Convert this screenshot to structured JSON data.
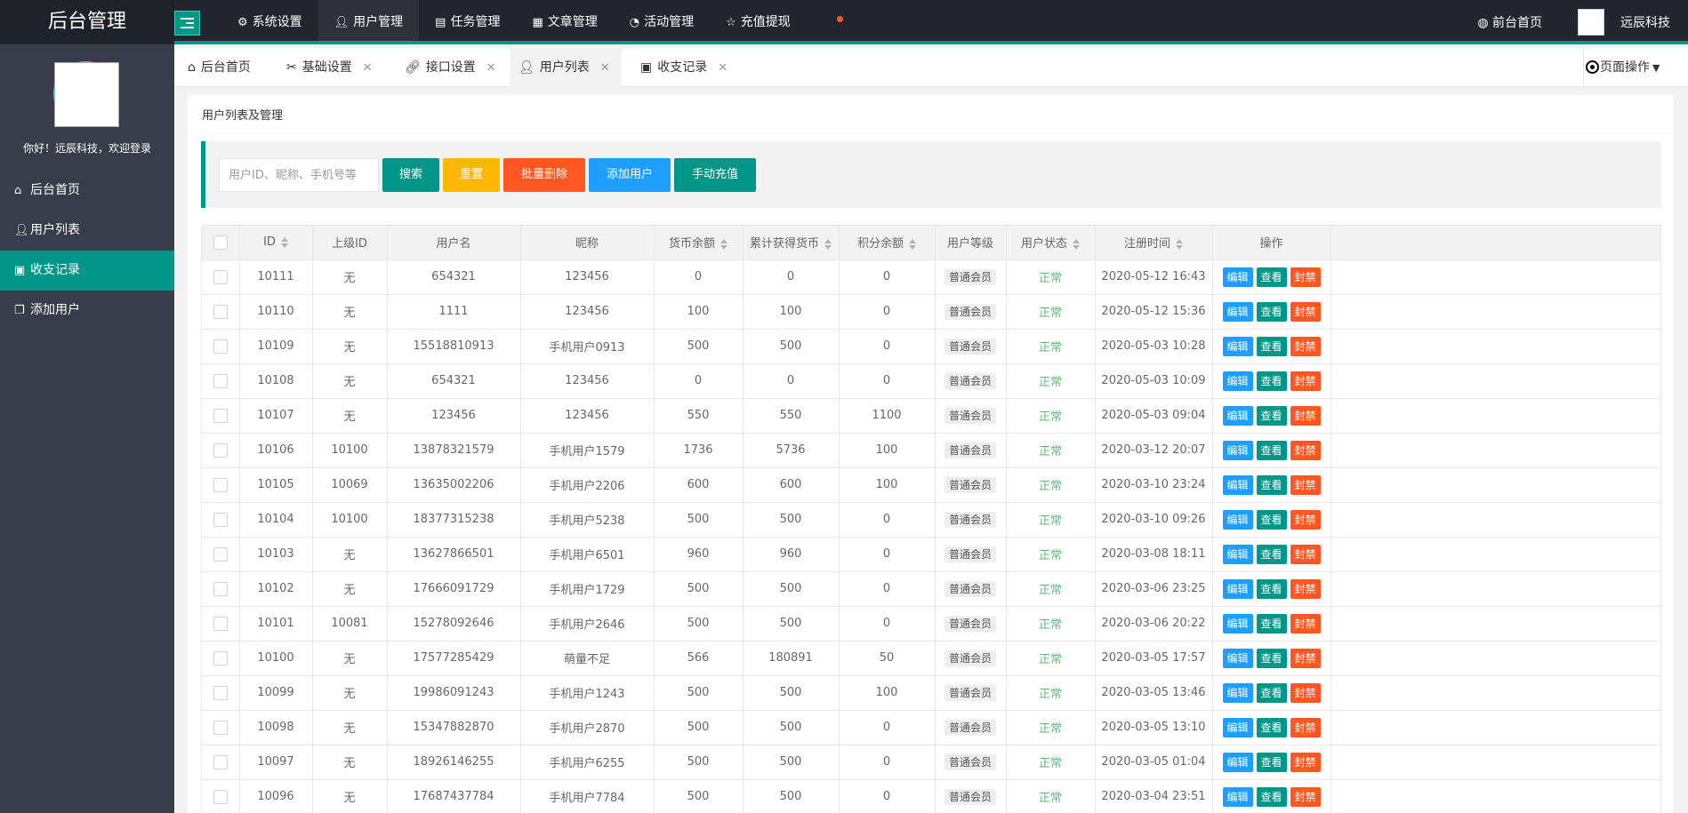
{
  "app": {
    "title": "后台管理"
  },
  "topnav": [
    {
      "label": "系统设置",
      "icon": "gear-icon"
    },
    {
      "label": "用户管理",
      "icon": "user-icon",
      "active": true
    },
    {
      "label": "任务管理",
      "icon": "task-icon"
    },
    {
      "label": "文章管理",
      "icon": "article-icon"
    },
    {
      "label": "活动管理",
      "icon": "gauge-icon"
    },
    {
      "label": "充值提现",
      "icon": "star-icon"
    }
  ],
  "header_right": {
    "front_label": "前台首页",
    "username": "远辰科技"
  },
  "sidebar": {
    "welcome": "你好！远辰科技，欢迎登录",
    "items": [
      {
        "label": "后台首页",
        "icon": "home-icon"
      },
      {
        "label": "用户列表",
        "icon": "user-icon"
      },
      {
        "label": "收支记录",
        "icon": "image-icon",
        "active": true
      },
      {
        "label": "添加用户",
        "icon": "copy-icon"
      }
    ]
  },
  "tabs": [
    {
      "label": "后台首页",
      "icon": "home-icon",
      "closable": false
    },
    {
      "label": "基础设置",
      "icon": "tools-icon",
      "closable": true
    },
    {
      "label": "接口设置",
      "icon": "link-icon",
      "closable": true
    },
    {
      "label": "用户列表",
      "icon": "user-icon",
      "closable": true,
      "active": true
    },
    {
      "label": "收支记录",
      "icon": "image-icon",
      "closable": true
    }
  ],
  "page_ops_label": "页面操作",
  "card": {
    "title": "用户列表及管理"
  },
  "toolbar": {
    "search_placeholder": "用户ID、昵称、手机号等",
    "search_value": "",
    "search_label": "搜索",
    "reset_label": "重置",
    "bulk_delete_label": "批量删除",
    "add_user_label": "添加用户",
    "manual_charge_label": "手动充值"
  },
  "table": {
    "columns": [
      "ID",
      "上级ID",
      "用户名",
      "昵称",
      "货币余额",
      "累计获得货币",
      "积分余额",
      "用户等级",
      "用户状态",
      "注册时间",
      "操作"
    ],
    "actions": {
      "edit": "编辑",
      "view": "查看",
      "ban": "封禁"
    },
    "rows": [
      {
        "id": "10111",
        "parent": "无",
        "username": "654321",
        "nickname": "123456",
        "balance": "0",
        "earned": "0",
        "points": "0",
        "level": "普通会员",
        "status": "正常",
        "registered": "2020-05-12 16:43"
      },
      {
        "id": "10110",
        "parent": "无",
        "username": "1111",
        "nickname": "123456",
        "balance": "100",
        "earned": "100",
        "points": "0",
        "level": "普通会员",
        "status": "正常",
        "registered": "2020-05-12 15:36"
      },
      {
        "id": "10109",
        "parent": "无",
        "username": "15518810913",
        "nickname": "手机用户0913",
        "balance": "500",
        "earned": "500",
        "points": "0",
        "level": "普通会员",
        "status": "正常",
        "registered": "2020-05-03 10:28"
      },
      {
        "id": "10108",
        "parent": "无",
        "username": "654321",
        "nickname": "123456",
        "balance": "0",
        "earned": "0",
        "points": "0",
        "level": "普通会员",
        "status": "正常",
        "registered": "2020-05-03 10:09"
      },
      {
        "id": "10107",
        "parent": "无",
        "username": "123456",
        "nickname": "123456",
        "balance": "550",
        "earned": "550",
        "points": "1100",
        "level": "普通会员",
        "status": "正常",
        "registered": "2020-05-03 09:04"
      },
      {
        "id": "10106",
        "parent": "10100",
        "username": "13878321579",
        "nickname": "手机用户1579",
        "balance": "1736",
        "earned": "5736",
        "points": "100",
        "level": "普通会员",
        "status": "正常",
        "registered": "2020-03-12 20:07"
      },
      {
        "id": "10105",
        "parent": "10069",
        "username": "13635002206",
        "nickname": "手机用户2206",
        "balance": "600",
        "earned": "600",
        "points": "100",
        "level": "普通会员",
        "status": "正常",
        "registered": "2020-03-10 23:24"
      },
      {
        "id": "10104",
        "parent": "10100",
        "username": "18377315238",
        "nickname": "手机用户5238",
        "balance": "500",
        "earned": "500",
        "points": "0",
        "level": "普通会员",
        "status": "正常",
        "registered": "2020-03-10 09:26"
      },
      {
        "id": "10103",
        "parent": "无",
        "username": "13627866501",
        "nickname": "手机用户6501",
        "balance": "960",
        "earned": "960",
        "points": "0",
        "level": "普通会员",
        "status": "正常",
        "registered": "2020-03-08 18:11"
      },
      {
        "id": "10102",
        "parent": "无",
        "username": "17666091729",
        "nickname": "手机用户1729",
        "balance": "500",
        "earned": "500",
        "points": "0",
        "level": "普通会员",
        "status": "正常",
        "registered": "2020-03-06 23:25"
      },
      {
        "id": "10101",
        "parent": "10081",
        "username": "15278092646",
        "nickname": "手机用户2646",
        "balance": "500",
        "earned": "500",
        "points": "0",
        "level": "普通会员",
        "status": "正常",
        "registered": "2020-03-06 20:22"
      },
      {
        "id": "10100",
        "parent": "无",
        "username": "17577285429",
        "nickname": "萌量不足",
        "balance": "566",
        "earned": "180891",
        "points": "50",
        "level": "普通会员",
        "status": "正常",
        "registered": "2020-03-05 17:57"
      },
      {
        "id": "10099",
        "parent": "无",
        "username": "19986091243",
        "nickname": "手机用户1243",
        "balance": "500",
        "earned": "500",
        "points": "100",
        "level": "普通会员",
        "status": "正常",
        "registered": "2020-03-05 13:46"
      },
      {
        "id": "10098",
        "parent": "无",
        "username": "15347882870",
        "nickname": "手机用户2870",
        "balance": "500",
        "earned": "500",
        "points": "0",
        "level": "普通会员",
        "status": "正常",
        "registered": "2020-03-05 13:10"
      },
      {
        "id": "10097",
        "parent": "无",
        "username": "18926146255",
        "nickname": "手机用户6255",
        "balance": "500",
        "earned": "500",
        "points": "0",
        "level": "普通会员",
        "status": "正常",
        "registered": "2020-03-05 01:04"
      },
      {
        "id": "10096",
        "parent": "无",
        "username": "17687437784",
        "nickname": "手机用户7784",
        "balance": "500",
        "earned": "500",
        "points": "0",
        "level": "普通会员",
        "status": "正常",
        "registered": "2020-03-04 23:51"
      }
    ]
  },
  "colors": {
    "accent": "#009688",
    "warn": "#ffb800",
    "danger": "#ff5722",
    "info": "#1e9fff",
    "status_ok": "#5fb878",
    "header_bg": "#23262e",
    "sidebar_bg": "#393d49"
  }
}
